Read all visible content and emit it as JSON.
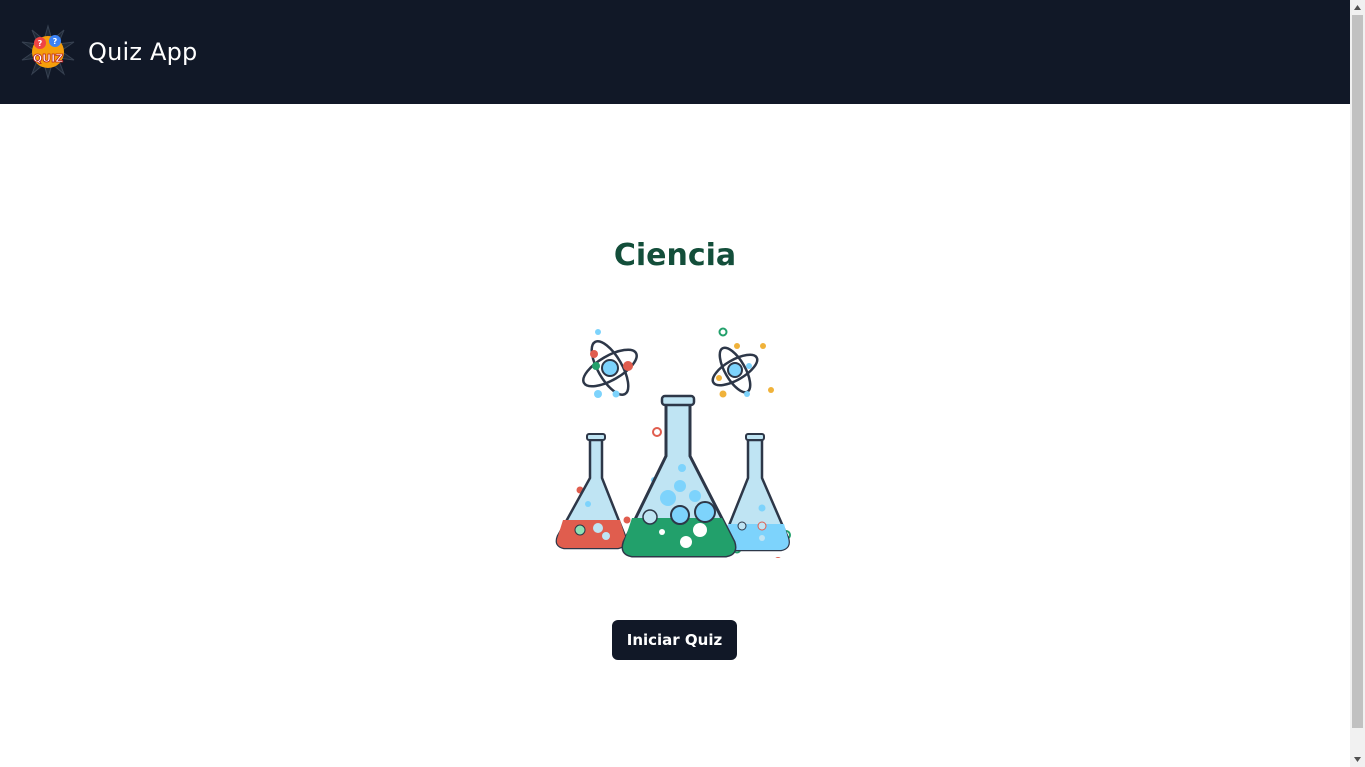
{
  "header": {
    "logo_text": "QUIZ",
    "title": "Quiz App"
  },
  "main": {
    "topic_title": "Ciencia",
    "illustration_icon": "science-flasks-icon",
    "start_button_label": "Iniciar Quiz"
  },
  "colors": {
    "navbar_bg": "#111827",
    "title_color": "#134e3a",
    "button_bg": "#111827",
    "button_text": "#ffffff"
  }
}
